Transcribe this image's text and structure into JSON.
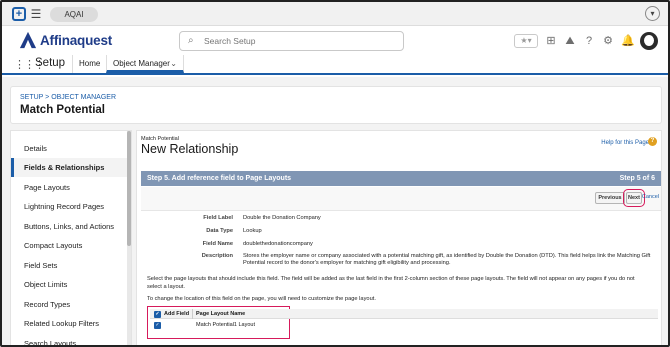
{
  "topbar": {
    "pill": "AQAI",
    "plus_icon": "+",
    "menu_icon": "☰",
    "profile_icon": "▾"
  },
  "header": {
    "brand": "Affinaquest",
    "search_placeholder": "Search Setup",
    "icons": [
      "star-icon",
      "add-icon",
      "trailhead-icon",
      "help-icon",
      "gear-icon",
      "bell-icon",
      "avatar"
    ]
  },
  "nav": {
    "app_name": "Setup",
    "tabs": [
      "Home",
      "Object Manager"
    ]
  },
  "breadcrumb": {
    "path": "SETUP > OBJECT MANAGER",
    "title": "Match Potential"
  },
  "sidebar": {
    "items": [
      "Details",
      "Fields & Relationships",
      "Page Layouts",
      "Lightning Record Pages",
      "Buttons, Links, and Actions",
      "Compact Layouts",
      "Field Sets",
      "Object Limits",
      "Record Types",
      "Related Lookup Filters",
      "Search Layouts"
    ],
    "active_index": 1
  },
  "main": {
    "object_label": "Match Potential",
    "page_heading": "New Relationship",
    "help_link": "Help for this Page",
    "step_title": "Step 5. Add reference field to Page Layouts",
    "step_count": "Step 5 of 6",
    "buttons": {
      "previous": "Previous",
      "next": "Next",
      "cancel": "Cancel"
    },
    "fields": [
      {
        "label": "Field Label",
        "value": "Double the Donation Company"
      },
      {
        "label": "Data Type",
        "value": "Lookup"
      },
      {
        "label": "Field Name",
        "value": "doublethedonationcompany"
      },
      {
        "label": "Description",
        "value": "Stores the employer name or company associated with a potential matching gift, as identified by Double the Donation (DTD). This field helps link the Matching Gift Potential record to the donor's employer for matching gift eligibility and processing."
      }
    ],
    "instruction_1": "Select the page layouts that should include this field. The field will be added as the last field in the first 2-column section of these page layouts. The field will not appear on any pages if you do not select a layout.",
    "instruction_2": "To change the location of this field on the page, you will need to customize the page layout.",
    "table": {
      "col_add": "Add Field",
      "col_name": "Page Layout Name",
      "rows": [
        {
          "checked": true,
          "name": "Match Potential1 Layout"
        }
      ]
    }
  },
  "colors": {
    "brand": "#1f3c88",
    "link": "#1b5da8",
    "step_bar": "#8096b4",
    "highlight": "#d61a5b"
  }
}
